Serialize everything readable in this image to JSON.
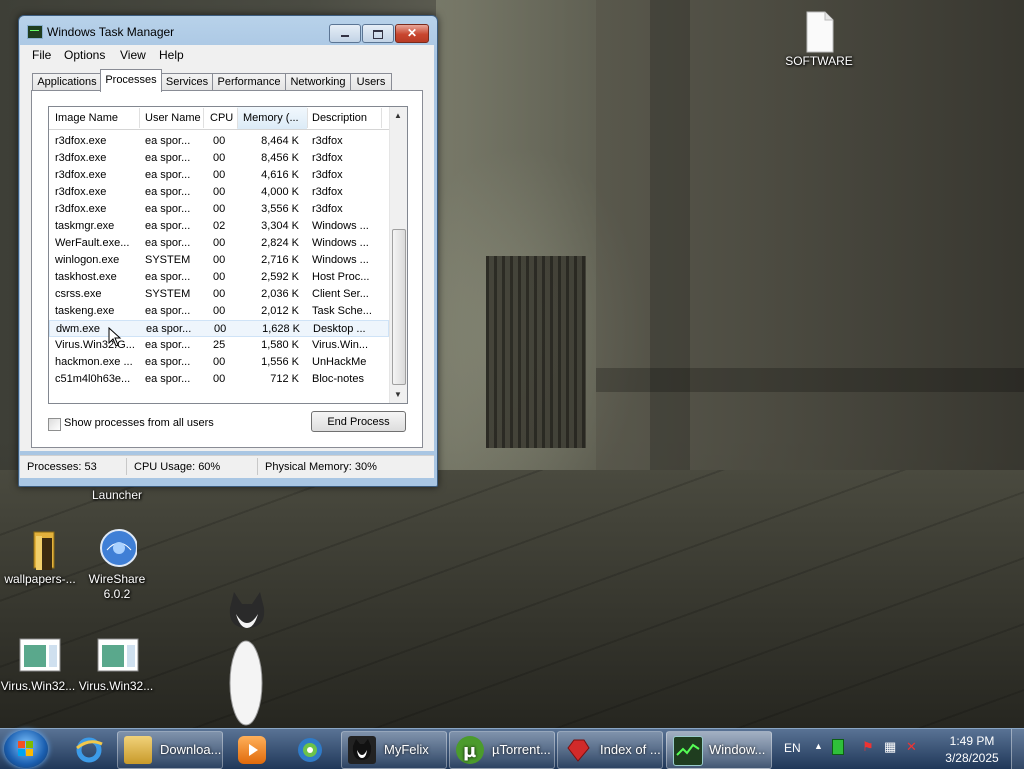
{
  "desktop": {
    "icons": [
      {
        "id": "software",
        "label": "SOFTWARE"
      },
      {
        "id": "flash-launcher",
        "label": "Launcher"
      },
      {
        "id": "wallpapers",
        "label": "wallpapers-..."
      },
      {
        "id": "wireshare",
        "label": "WireShare 6.0.2"
      },
      {
        "id": "virus1",
        "label": "Virus.Win32..."
      },
      {
        "id": "virus2",
        "label": "Virus.Win32..."
      }
    ]
  },
  "window": {
    "title": "Windows Task Manager",
    "menu": [
      "File",
      "Options",
      "View",
      "Help"
    ],
    "tabs": [
      "Applications",
      "Processes",
      "Services",
      "Performance",
      "Networking",
      "Users"
    ],
    "active_tab": "Processes",
    "columns": [
      "Image Name",
      "User Name",
      "CPU",
      "Memory (...",
      "Description"
    ],
    "rows": [
      [
        "r3dfox.exe",
        "ea spor...",
        "00",
        "8,464 K",
        "r3dfox"
      ],
      [
        "r3dfox.exe",
        "ea spor...",
        "00",
        "8,456 K",
        "r3dfox"
      ],
      [
        "r3dfox.exe",
        "ea spor...",
        "00",
        "4,616 K",
        "r3dfox"
      ],
      [
        "r3dfox.exe",
        "ea spor...",
        "00",
        "4,000 K",
        "r3dfox"
      ],
      [
        "r3dfox.exe",
        "ea spor...",
        "00",
        "3,556 K",
        "r3dfox"
      ],
      [
        "taskmgr.exe",
        "ea spor...",
        "02",
        "3,304 K",
        "Windows ..."
      ],
      [
        "WerFault.exe...",
        "ea spor...",
        "00",
        "2,824 K",
        "Windows ..."
      ],
      [
        "winlogon.exe",
        "SYSTEM",
        "00",
        "2,716 K",
        "Windows ..."
      ],
      [
        "taskhost.exe",
        "ea spor...",
        "00",
        "2,592 K",
        "Host Proc..."
      ],
      [
        "csrss.exe",
        "SYSTEM",
        "00",
        "2,036 K",
        "Client Ser..."
      ],
      [
        "taskeng.exe",
        "ea spor...",
        "00",
        "2,012 K",
        "Task Sche..."
      ],
      [
        "dwm.exe",
        "ea spor...",
        "00",
        "1,628 K",
        "Desktop ..."
      ],
      [
        "Virus.Win32.G...",
        "ea spor...",
        "25",
        "1,580 K",
        "Virus.Win..."
      ],
      [
        "hackmon.exe ...",
        "ea spor...",
        "00",
        "1,556 K",
        "UnHackMe"
      ],
      [
        "c51m4l0h63e...",
        "ea spor...",
        "00",
        "712 K",
        "Bloc-notes"
      ]
    ],
    "selected_row": 11,
    "show_all_label": "Show processes from all users",
    "end_process_label": "End Process",
    "status": {
      "processes": "Processes: 53",
      "cpu": "CPU Usage: 60%",
      "memory": "Physical Memory: 30%"
    }
  },
  "taskbar": {
    "pinned": [
      "ie-icon",
      "media-player-icon",
      "browser-globe-icon"
    ],
    "tasks": [
      {
        "label": "Downloa...",
        "icon": "folder-icon"
      },
      {
        "label": "MyFelix",
        "icon": "cat-icon"
      },
      {
        "label": "µTorrent...",
        "icon": "utorrent-icon"
      },
      {
        "label": "Index of ...",
        "icon": "ruby-icon"
      },
      {
        "label": "Window...",
        "icon": "taskmgr-icon"
      }
    ],
    "tray": {
      "lang": "EN",
      "time": "1:49 PM",
      "date": "3/28/2025"
    }
  },
  "colors": {
    "selection": "#eef5fc",
    "titlebar": "#a9c6e3",
    "close": "#c8462f",
    "taskbar": "#1d3e6a"
  }
}
